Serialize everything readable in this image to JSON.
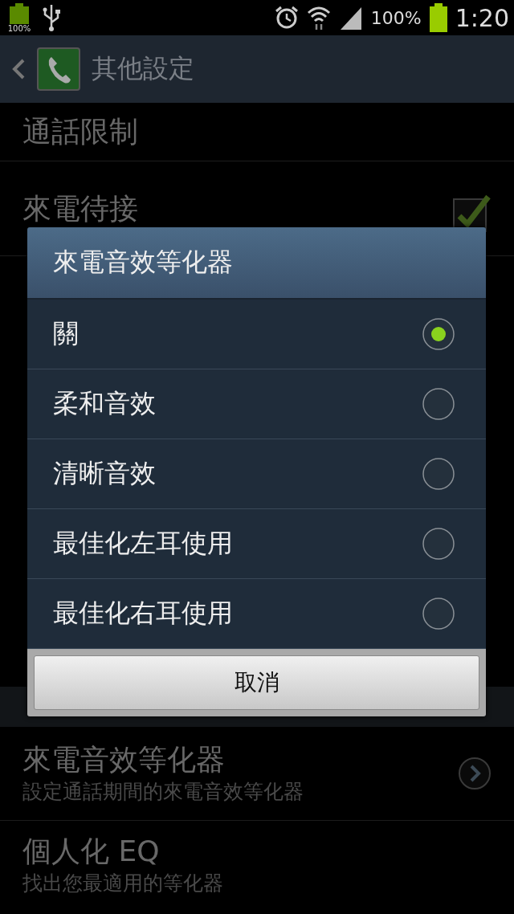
{
  "status_bar": {
    "battery_badge": "100%",
    "battery_percent": "100%",
    "time": "1:20"
  },
  "action_bar": {
    "title": "其他設定"
  },
  "settings": [
    {
      "kind": "plain",
      "title": "通話限制"
    },
    {
      "kind": "checkbox",
      "title": "來電待接",
      "checked": true
    },
    {
      "kind": "covered"
    },
    {
      "kind": "section"
    },
    {
      "kind": "link",
      "title": "來電音效等化器",
      "subtitle": "設定通話期間的來電音效等化器"
    },
    {
      "kind": "plain",
      "title": "個人化 EQ",
      "subtitle": "找出您最適用的等化器"
    }
  ],
  "dialog": {
    "title": "來電音效等化器",
    "options": [
      {
        "label": "關",
        "selected": true
      },
      {
        "label": "柔和音效",
        "selected": false
      },
      {
        "label": "清晰音效",
        "selected": false
      },
      {
        "label": "最佳化左耳使用",
        "selected": false
      },
      {
        "label": "最佳化右耳使用",
        "selected": false
      }
    ],
    "buttons": [
      "取消"
    ]
  }
}
